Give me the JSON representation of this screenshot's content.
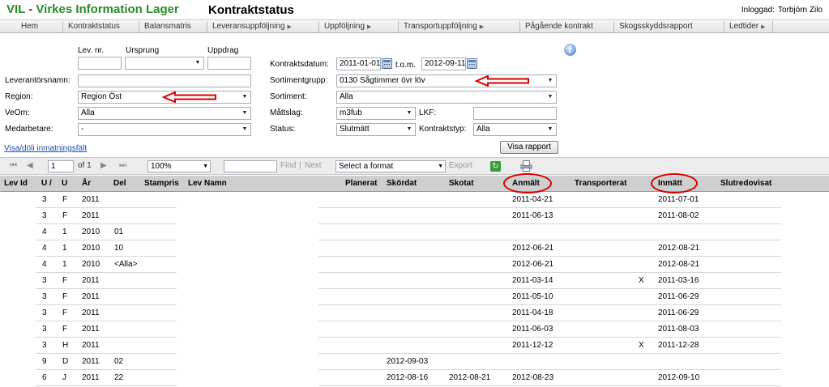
{
  "header": {
    "brand": "VIL - Virkes Information Lager",
    "brand_left": "VIL",
    "brand_sep": " - ",
    "brand_right": "Virkes Information Lager",
    "page_title": "Kontraktstatus",
    "logged_in_label": "Inloggad:",
    "user_name": "Torbjörn Zilo"
  },
  "nav": {
    "items": [
      {
        "label": "Hem",
        "has_submenu": false
      },
      {
        "label": "Kontraktstatus",
        "has_submenu": false
      },
      {
        "label": "Balansmatris",
        "has_submenu": false
      },
      {
        "label": "Leveransuppföljning",
        "has_submenu": true
      },
      {
        "label": "Uppföljning",
        "has_submenu": true
      },
      {
        "label": "Transportuppföljning",
        "has_submenu": true
      },
      {
        "label": "Pågående kontrakt",
        "has_submenu": false
      },
      {
        "label": "Skogsskyddsrapport",
        "has_submenu": false
      },
      {
        "label": "Ledtider",
        "has_submenu": true
      }
    ],
    "submenu_glyph": "▶"
  },
  "form": {
    "lev_nr_label": "Lev. nr.",
    "lev_nr_value": "",
    "ursprung_label": "Ursprung",
    "ursprung_value": "",
    "uppdrag_label": "Uppdrag",
    "uppdrag_value": "",
    "leverantorsnamn_label": "Leverantörsnamn:",
    "leverantorsnamn_value": "",
    "region_label": "Region:",
    "region_value": "Region Öst",
    "veom_label": "VeOm:",
    "veom_value": "Alla",
    "medarbetare_label": "Medarbetare:",
    "medarbetare_value": "-",
    "kontraktsdatum_label": "Kontraktsdatum:",
    "kontraktsdatum_from": "2011-01-01",
    "tom_label": "t.o.m.",
    "kontraktsdatum_to": "2012-09-11",
    "sortimentgrupp_label": "Sortimentgrupp:",
    "sortimentgrupp_value": "0130 Sågtimmer övr löv",
    "sortiment_label": "Sortiment:",
    "sortiment_value": "Alla",
    "mattslag_label": "Måttslag:",
    "mattslag_value": "m3fub",
    "lkf_label": "LKF:",
    "lkf_value": "",
    "status_label": "Status:",
    "status_value": "Slutmätt",
    "kontraktstyp_label": "Kontraktstyp:",
    "kontraktstyp_value": "Alla",
    "toggle_link": "Visa/döli inmatningsfält",
    "show_report_button": "Visa rapport",
    "dropdown_glyph": "▼",
    "info_glyph": "i"
  },
  "toolbar": {
    "first_glyph": "⏮",
    "prev_glyph": "◀",
    "page_value": "1",
    "of_label": "of 1",
    "next_glyph": "▶",
    "last_glyph": "⏭",
    "zoom_value": "100%",
    "find_value": "",
    "find_label": "Find",
    "separator": "|",
    "next_label": "Next",
    "format_value": "Select a format",
    "export_label": "Export",
    "refresh_glyph": "↻"
  },
  "table": {
    "headers": {
      "lev_id": "Lev Id",
      "u1": "U /",
      "u2": "U",
      "ar": "År",
      "del": "Del",
      "stampris": "Stampris",
      "lev_namn": "Lev Namn",
      "planerat": "Planerat",
      "skordat": "Skördat",
      "skotat": "Skotat",
      "anmalt": "Anmält",
      "transporterat": "Transporterat",
      "inmatt": "Inmätt",
      "slutredovisat": "Slutredovisat"
    },
    "rows": [
      {
        "lev_id": "3",
        "u1": "F",
        "ar": "2011",
        "del": "",
        "skordat": "",
        "skotat": "",
        "anmalt": "2011-04-21",
        "transporterat": "",
        "inmatt": "2011-07-01"
      },
      {
        "lev_id": "3",
        "u1": "F",
        "ar": "2011",
        "del": "",
        "skordat": "",
        "skotat": "",
        "anmalt": "2011-06-13",
        "transporterat": "",
        "inmatt": "2011-08-02"
      },
      {
        "lev_id": "4",
        "u1": "1",
        "ar": "2010",
        "del": "01",
        "skordat": "",
        "skotat": "",
        "anmalt": "",
        "transporterat": "",
        "inmatt": ""
      },
      {
        "lev_id": "4",
        "u1": "1",
        "ar": "2010",
        "del": "10",
        "skordat": "",
        "skotat": "",
        "anmalt": "2012-06-21",
        "transporterat": "",
        "inmatt": "2012-08-21"
      },
      {
        "lev_id": "4",
        "u1": "1",
        "ar": "2010",
        "del": "<Alla>",
        "skordat": "",
        "skotat": "",
        "anmalt": "2012-06-21",
        "transporterat": "",
        "inmatt": "2012-08-21"
      },
      {
        "lev_id": "3",
        "u1": "F",
        "ar": "2011",
        "del": "",
        "skordat": "",
        "skotat": "",
        "anmalt": "2011-03-14",
        "transporterat": "X",
        "inmatt": "2011-03-16"
      },
      {
        "lev_id": "3",
        "u1": "F",
        "ar": "2011",
        "del": "",
        "skordat": "",
        "skotat": "",
        "anmalt": "2011-05-10",
        "transporterat": "",
        "inmatt": "2011-06-29"
      },
      {
        "lev_id": "3",
        "u1": "F",
        "ar": "2011",
        "del": "",
        "skordat": "",
        "skotat": "",
        "anmalt": "2011-04-18",
        "transporterat": "",
        "inmatt": "2011-06-29"
      },
      {
        "lev_id": "3",
        "u1": "F",
        "ar": "2011",
        "del": "",
        "skordat": "",
        "skotat": "",
        "anmalt": "2011-06-03",
        "transporterat": "",
        "inmatt": "2011-08-03"
      },
      {
        "lev_id": "3",
        "u1": "H",
        "ar": "2011",
        "del": "",
        "skordat": "",
        "skotat": "",
        "anmalt": "2011-12-12",
        "transporterat": "X",
        "inmatt": "2011-12-28"
      },
      {
        "lev_id": "9",
        "u1": "D",
        "ar": "2011",
        "del": "02",
        "skordat": "2012-09-03",
        "skotat": "",
        "anmalt": "",
        "transporterat": "",
        "inmatt": ""
      },
      {
        "lev_id": "6",
        "u1": "J",
        "ar": "2011",
        "del": "22",
        "skordat": "2012-08-16",
        "skotat": "2012-08-21",
        "anmalt": "2012-08-23",
        "transporterat": "",
        "inmatt": "2012-09-10"
      }
    ]
  },
  "colors": {
    "brand_green": "#2a8a2a",
    "brand_red": "#cc0000",
    "annotation_red": "#d40000",
    "link_blue": "#1a4fb0",
    "table_header_bg": "#cfcfcf",
    "toolbar_bg": "#ececec"
  }
}
